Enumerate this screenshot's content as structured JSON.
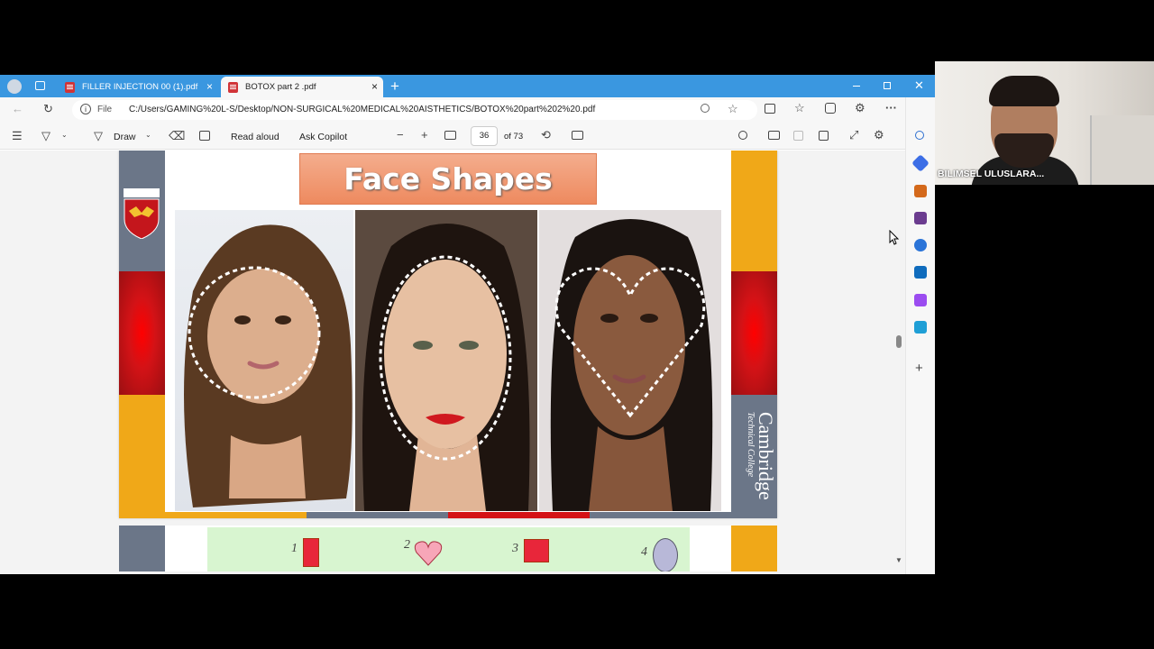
{
  "tabs": [
    {
      "label": "FILLER INJECTION 00 (1).pdf",
      "close": "×"
    },
    {
      "label": "BOTOX part 2 .pdf",
      "close": "×"
    }
  ],
  "address": {
    "file_label": "File",
    "url": "C:/Users/GAMING%20L-S/Desktop/NON-SURGICAL%20MEDICAL%20AISTHETICS/BOTOX%20part%202%20.pdf"
  },
  "pdf_toolbar": {
    "draw_label": "Draw",
    "read_aloud_label": "Read aloud",
    "ask_copilot_label": "Ask Copilot",
    "page_number": "36",
    "page_total": "of 73"
  },
  "slide": {
    "title": "Face Shapes",
    "college_name": "Cambridge",
    "college_sub": "Technical College"
  },
  "next_slide": {
    "numbers": [
      "1",
      "2",
      "3",
      "4"
    ]
  },
  "webcam": {
    "participant_name": "BILIMSEL ULUSLARA..."
  },
  "colors": {
    "tabbar": "#3a97e0",
    "accent_orange": "#f0a818",
    "accent_red": "#d41216",
    "slate": "#6b7688"
  }
}
